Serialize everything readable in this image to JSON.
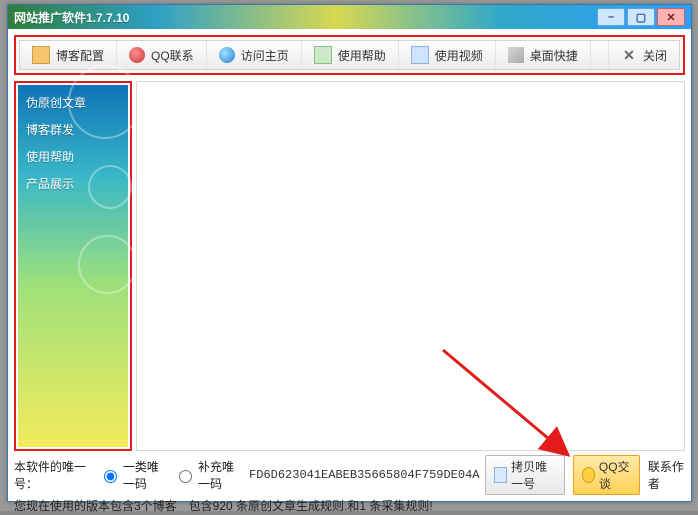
{
  "window": {
    "title": "网站推广软件1.7.7.10"
  },
  "toolbar": {
    "items": [
      {
        "label": "博客配置",
        "icon": "blog-config-icon"
      },
      {
        "label": "QQ联系",
        "icon": "qq-contact-icon"
      },
      {
        "label": "访问主页",
        "icon": "globe-icon"
      },
      {
        "label": "使用帮助",
        "icon": "help-icon"
      },
      {
        "label": "使用视频",
        "icon": "video-icon"
      },
      {
        "label": "桌面快捷",
        "icon": "desktop-shortcut-icon"
      }
    ],
    "close_label": "关闭"
  },
  "sidebar": {
    "items": [
      {
        "label": "伪原创文章"
      },
      {
        "label": "博客群发"
      },
      {
        "label": "使用帮助"
      },
      {
        "label": "产品展示"
      }
    ]
  },
  "footer": {
    "unique_label": "本软件的唯一号：",
    "radio1": "一类唯一码",
    "radio2": "补充唯一码",
    "code_value": "FD6D623041EABEB35665804F759DE04A",
    "status_line": "您现在使用的版本包含3个博客　包含920 条原创文章生成规则.和1 条采集规则!",
    "copy_btn": "拷贝唯一号",
    "qq_badge": "QQ交谈",
    "contact_author": "联系作者"
  }
}
